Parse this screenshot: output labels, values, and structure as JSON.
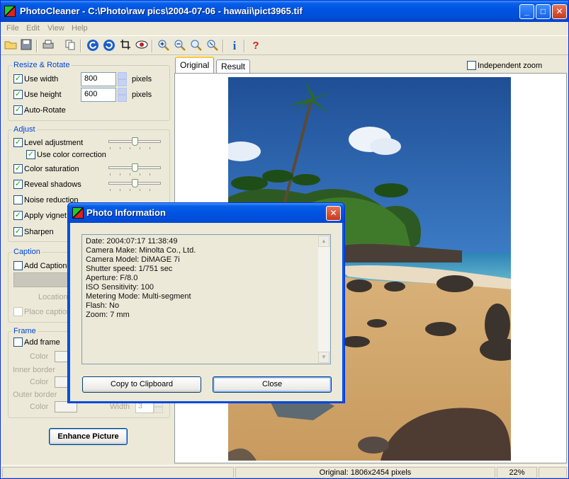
{
  "window": {
    "title": "PhotoCleaner - C:\\Photo\\raw pics\\2004-07-06 - hawaii\\pict3965.tif",
    "minimize_glyph": "_",
    "maximize_glyph": "□",
    "close_glyph": "✕"
  },
  "menu": {
    "file": "File",
    "edit": "Edit",
    "view": "View",
    "help": "Help"
  },
  "toolbar": {
    "icons": [
      "open-folder-icon",
      "save-icon",
      "print-icon",
      "copy-icon",
      "rotate-left-icon",
      "rotate-right-icon",
      "crop-icon",
      "eye-icon",
      "zoom-in-icon",
      "zoom-out-icon",
      "zoom-fit-icon",
      "zoom-actual-icon",
      "info-icon",
      "help-icon"
    ],
    "info_glyph": "i",
    "help_glyph": "?"
  },
  "resize": {
    "legend": "Resize & Rotate",
    "use_width": {
      "label": "Use width",
      "checked": true,
      "value": "800",
      "unit": "pixels"
    },
    "use_height": {
      "label": "Use height",
      "checked": true,
      "value": "600",
      "unit": "pixels"
    },
    "auto_rotate": {
      "label": "Auto-Rotate",
      "checked": true
    }
  },
  "adjust": {
    "legend": "Adjust",
    "level": {
      "label": "Level adjustment",
      "checked": true,
      "slider": 0.5
    },
    "color_corr": {
      "label": "Use color correction",
      "checked": true
    },
    "saturation": {
      "label": "Color saturation",
      "checked": true,
      "slider": 0.5
    },
    "shadows": {
      "label": "Reveal shadows",
      "checked": true,
      "slider": 0.5
    },
    "noise": {
      "label": "Noise reduction",
      "checked": false
    },
    "vignet": {
      "label": "Apply vignet",
      "checked": true
    },
    "sharpen": {
      "label": "Sharpen",
      "checked": true
    }
  },
  "caption": {
    "legend": "Caption",
    "add": {
      "label": "Add Caption",
      "checked": false
    },
    "location_label": "Location",
    "place": {
      "label": "Place caption",
      "checked": false
    }
  },
  "frame": {
    "legend": "Frame",
    "add": {
      "label": "Add frame",
      "checked": false
    },
    "color_label": "Color",
    "inner_label": "Inner border",
    "inner_color_label": "Color",
    "outer_label": "Outer border",
    "outer_color_label": "Color",
    "width_label": "Width",
    "width_value": "3"
  },
  "enhance_label": "Enhance Picture",
  "tabs": {
    "original": "Original",
    "result": "Result"
  },
  "independent_zoom": {
    "label": "Independent zoom",
    "checked": false
  },
  "status": {
    "original": "Original: 1806x2454 pixels",
    "zoom": "22%"
  },
  "dialog": {
    "title": "Photo Information",
    "close_glyph": "✕",
    "lines": [
      "Date: 2004:07:17 11:38:49",
      "Camera Make: Minolta Co., Ltd.",
      "Camera Model: DiMAGE 7i",
      "Shutter speed: 1/751 sec",
      "Aperture: F/8.0",
      "ISO Sensitivity: 100",
      "Metering Mode: Multi-segment",
      "Flash: No",
      "Zoom: 7 mm"
    ],
    "copy_label": "Copy to Clipboard",
    "close_label": "Close"
  },
  "colors": {
    "title_blue": "#0054e3",
    "panel_bg": "#ece9d8",
    "legend_blue": "#0046d5",
    "check_green": "#21a121"
  }
}
